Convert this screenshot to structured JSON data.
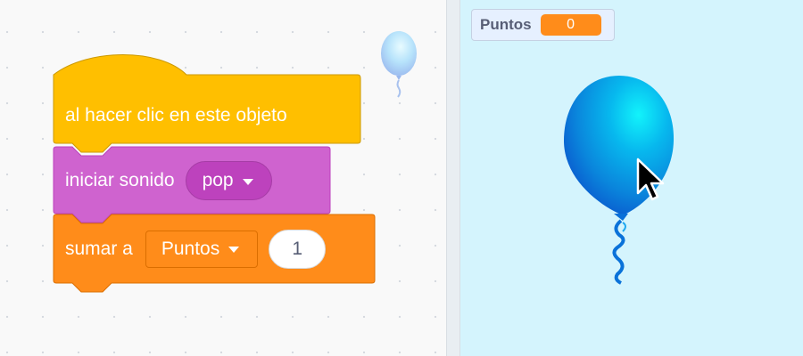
{
  "code_area": {
    "hat_block": {
      "label": "al hacer clic en este objeto",
      "color": "#ffbf00"
    },
    "sound_block": {
      "label": "iniciar sonido",
      "sound_name": "pop",
      "color": "#cf63cf"
    },
    "data_block": {
      "label": "sumar a",
      "variable_name": "Puntos",
      "amount": "1",
      "color": "#ff8c1a"
    }
  },
  "stage": {
    "variable_monitor": {
      "label": "Puntos",
      "value": "0"
    },
    "sprite": {
      "name": "balloon-icon",
      "color": "#0b8cdc"
    },
    "background_color": "#d4f4fd"
  }
}
